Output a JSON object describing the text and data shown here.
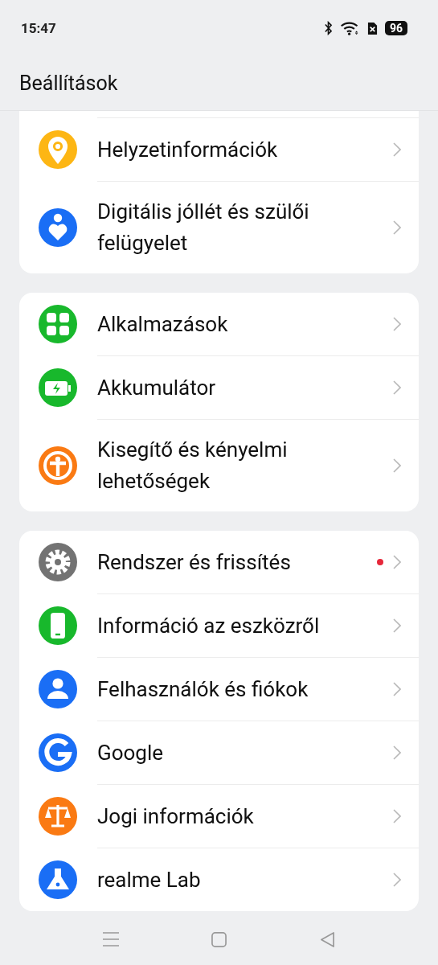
{
  "status_bar": {
    "time": "15:47",
    "battery": "96"
  },
  "header": {
    "title": "Beállítások"
  },
  "groups": [
    {
      "items": [
        {
          "label": "Helyzetinformációk",
          "color": "#fdb614",
          "has_dot": false
        },
        {
          "label": "Digitális jóllét és szülői felügyelet",
          "color": "#1a6ef5",
          "has_dot": false
        }
      ]
    },
    {
      "items": [
        {
          "label": "Alkalmazások",
          "color": "#18b82c",
          "has_dot": false
        },
        {
          "label": "Akkumulátor",
          "color": "#18b82c",
          "has_dot": false
        },
        {
          "label": "Kisegítő és kényelmi lehetőségek",
          "color": "#fa7a13",
          "has_dot": false
        }
      ]
    },
    {
      "items": [
        {
          "label": "Rendszer és frissítés",
          "color": "#737373",
          "has_dot": true
        },
        {
          "label": "Információ az eszközről",
          "color": "#18b82c",
          "has_dot": false
        },
        {
          "label": "Felhasználók és fiókok",
          "color": "#1a6ef5",
          "has_dot": false
        },
        {
          "label": "Google",
          "color": "#1a6ef5",
          "has_dot": false
        },
        {
          "label": "Jogi információk",
          "color": "#fa7a13",
          "has_dot": false
        },
        {
          "label": "realme Lab",
          "color": "#1a6ef5",
          "has_dot": false
        }
      ]
    }
  ]
}
